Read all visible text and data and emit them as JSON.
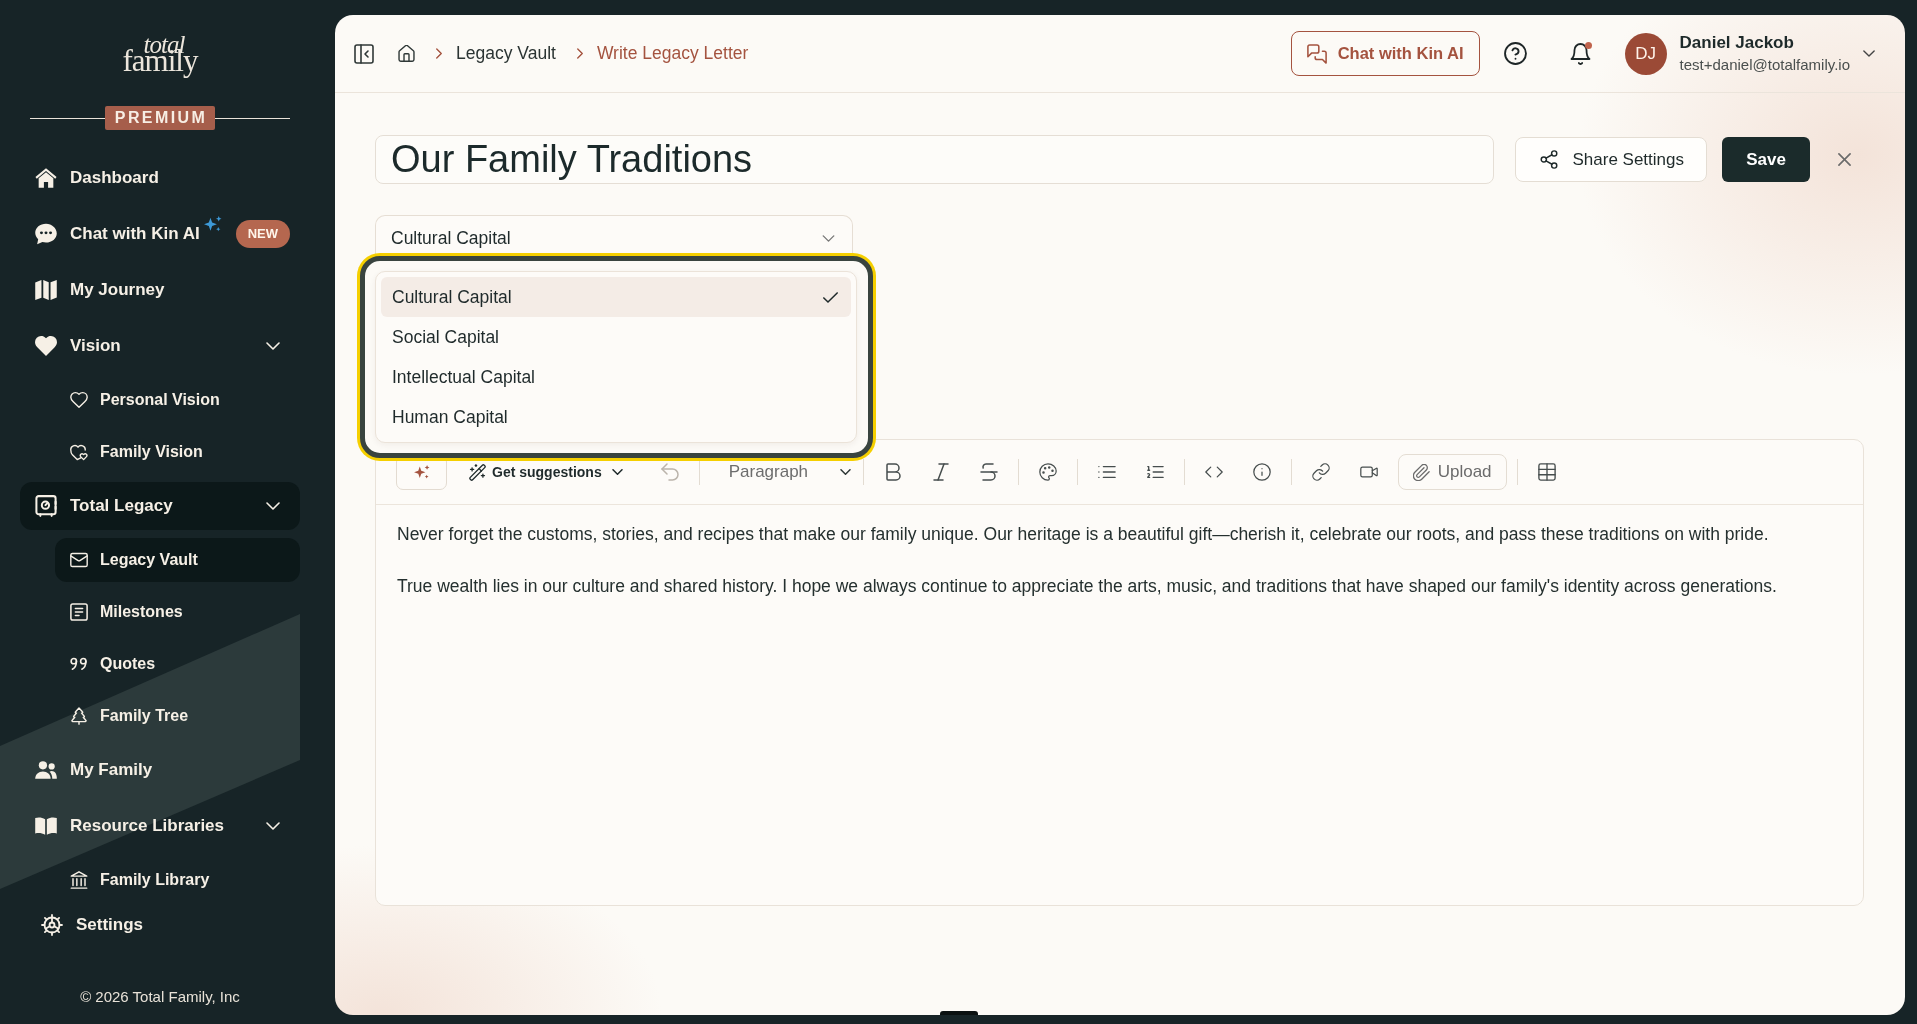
{
  "sidebar": {
    "logo": {
      "line_1": "total",
      "line_2": "family"
    },
    "plan_badge": "PREMIUM",
    "nav": [
      {
        "label": "Dashboard",
        "selected": false
      },
      {
        "label": "Chat with Kin AI",
        "badge": "NEW",
        "selected": false
      },
      {
        "label": "My Journey",
        "selected": false
      },
      {
        "label": "Vision",
        "selected": false,
        "expanded": true,
        "children": [
          {
            "label": "Personal Vision",
            "selected": false
          },
          {
            "label": "Family Vision",
            "selected": false
          }
        ]
      },
      {
        "label": "Total Legacy",
        "selected": true,
        "expanded": true,
        "children": [
          {
            "label": "Legacy Vault",
            "selected": true
          },
          {
            "label": "Milestones",
            "selected": false
          },
          {
            "label": "Quotes",
            "selected": false
          },
          {
            "label": "Family Tree",
            "selected": false
          }
        ]
      },
      {
        "label": "My Family",
        "selected": false
      },
      {
        "label": "Resource Libraries",
        "selected": false,
        "expanded": true,
        "children": [
          {
            "label": "Family Library",
            "selected": false
          }
        ]
      }
    ],
    "settings": {
      "label": "Settings"
    },
    "copyright": "© 2026 Total Family, Inc"
  },
  "header": {
    "breadcrumb": [
      {
        "label": "Legacy Vault",
        "current": false
      },
      {
        "label": "Write Legacy Letter",
        "current": true
      }
    ],
    "chat_button": {
      "label": "Chat with Kin AI"
    },
    "notifications": {
      "unread": true
    },
    "user": {
      "initials": "DJ",
      "name": "Daniel Jackob",
      "email": "test+daniel@totalfamily.io"
    }
  },
  "letter": {
    "title_field": {
      "value": "Our Family Traditions"
    },
    "share_button": {
      "label": "Share Settings"
    },
    "save_button": {
      "label": "Save"
    },
    "category_select": {
      "value": "Cultural Capital",
      "expanded": true,
      "highlighted": true,
      "options": [
        {
          "label": "Cultural Capital",
          "selected": true
        },
        {
          "label": "Social Capital",
          "selected": false
        },
        {
          "label": "Intellectual Capital",
          "selected": false
        },
        {
          "label": "Human Capital",
          "selected": false
        }
      ]
    },
    "toolbar": {
      "groups": [
        [
          {
            "kind": "ai",
            "disabled": false
          },
          {
            "kind": "menu",
            "label": "Get suggestions",
            "disabled": false
          },
          {
            "kind": "icon",
            "disabled": true
          }
        ],
        [
          {
            "kind": "select",
            "value": "Paragraph",
            "disabled": false
          }
        ],
        [
          {
            "kind": "icon",
            "disabled": false
          },
          {
            "kind": "icon",
            "disabled": false
          },
          {
            "kind": "icon",
            "disabled": false
          }
        ],
        [
          {
            "kind": "icon",
            "disabled": false
          }
        ],
        [
          {
            "kind": "icon",
            "disabled": false
          },
          {
            "kind": "icon",
            "disabled": false
          }
        ],
        [
          {
            "kind": "icon",
            "disabled": false
          },
          {
            "kind": "icon",
            "disabled": false
          }
        ],
        [
          {
            "kind": "icon",
            "disabled": false
          },
          {
            "kind": "icon",
            "disabled": false
          },
          {
            "kind": "button",
            "label": "Upload",
            "disabled": false
          }
        ],
        [
          {
            "kind": "icon",
            "disabled": false
          }
        ]
      ]
    },
    "paragraphs": [
      "Never forget the customs, stories, and recipes that make our family unique. Our heritage is a beautiful gift—cherish it, celebrate our roots, and pass these traditions on with pride.",
      "True wealth lies in our culture and shared history. I hope we always continue to appreciate the arts, music, and traditions that have shaped our family's identity across generations."
    ]
  }
}
